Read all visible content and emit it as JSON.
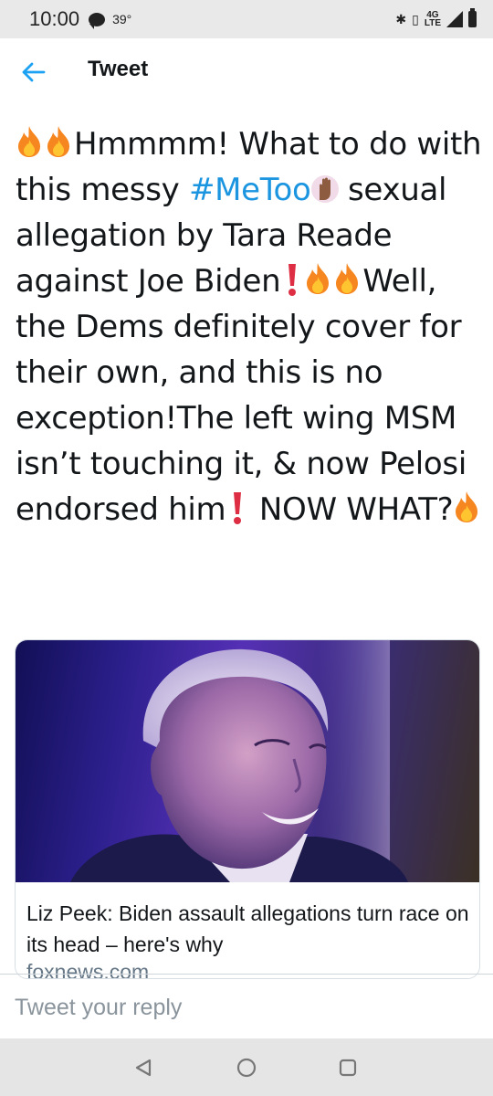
{
  "status_bar": {
    "time": "10:00",
    "temperature": "39°",
    "network_top": "4G",
    "network_bottom": "LTE"
  },
  "header": {
    "title": "Tweet",
    "back_icon": "arrow-left-icon"
  },
  "tweet": {
    "part1": "Hmmmm! What to do with this messy ",
    "hashtag": "#MeToo",
    "part2": " sexual allegation by Tara Reade against Joe Biden",
    "part3": "Well, the Dems definitely cover for their own, and this is no exception!The left wing MSM isn’t touching it, & now Pelosi endorsed him",
    "part4": " NOW WHAT?",
    "icons": [
      "fire-emoji",
      "raised-hand-emoji",
      "red-exclamation-emoji"
    ]
  },
  "link_card": {
    "title": "Liz Peek: Biden assault allegations turn race on its head – here's why",
    "domain": "foxnews.com"
  },
  "reply": {
    "placeholder": "Tweet your reply"
  },
  "colors": {
    "link": "#1b95e0",
    "accent": "#1da1f2",
    "text": "#14171a",
    "muted": "#657786"
  }
}
